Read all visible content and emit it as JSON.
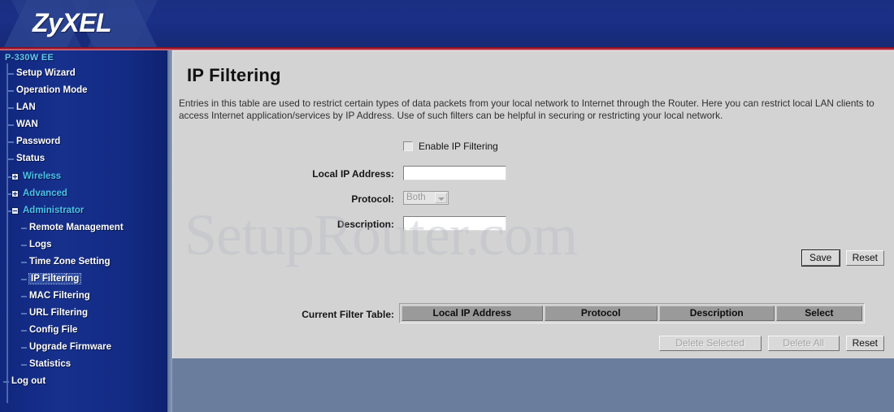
{
  "header": {
    "logo": "ZyXEL"
  },
  "sidebar": {
    "model": "P-330W EE",
    "items": [
      {
        "label": "Setup Wizard",
        "level": 1,
        "style": "white",
        "icon": "none"
      },
      {
        "label": "Operation Mode",
        "level": 1,
        "style": "white",
        "icon": "none"
      },
      {
        "label": "LAN",
        "level": 1,
        "style": "white",
        "icon": "none"
      },
      {
        "label": "WAN",
        "level": 1,
        "style": "white",
        "icon": "none"
      },
      {
        "label": "Password",
        "level": 1,
        "style": "white",
        "icon": "none"
      },
      {
        "label": "Status",
        "level": 1,
        "style": "white",
        "icon": "none"
      },
      {
        "label": "Wireless",
        "level": 1,
        "style": "cyan",
        "icon": "plus-box"
      },
      {
        "label": "Advanced",
        "level": 1,
        "style": "cyan",
        "icon": "plus-box"
      },
      {
        "label": "Administrator",
        "level": 1,
        "style": "cyan",
        "icon": "minus-box"
      },
      {
        "label": "Remote Management",
        "level": 2,
        "style": "white",
        "icon": "none"
      },
      {
        "label": "Logs",
        "level": 2,
        "style": "white",
        "icon": "none"
      },
      {
        "label": "Time Zone Setting",
        "level": 2,
        "style": "white",
        "icon": "none"
      },
      {
        "label": "IP Filtering",
        "level": 2,
        "style": "white",
        "icon": "none",
        "selected": true
      },
      {
        "label": "MAC Filtering",
        "level": 2,
        "style": "white",
        "icon": "none"
      },
      {
        "label": "URL Filtering",
        "level": 2,
        "style": "white",
        "icon": "none"
      },
      {
        "label": "Config File",
        "level": 2,
        "style": "white",
        "icon": "none"
      },
      {
        "label": "Upgrade Firmware",
        "level": 2,
        "style": "white",
        "icon": "none"
      },
      {
        "label": "Statistics",
        "level": 2,
        "style": "white",
        "icon": "none"
      },
      {
        "label": "Log out",
        "level": 0,
        "style": "white",
        "icon": "none"
      }
    ]
  },
  "main": {
    "title": "IP Filtering",
    "intro": "Entries in this table are used to restrict certain types of data packets from your local network to Internet through the Router. Here you can restrict local LAN clients to access Internet application/services by IP Address. Use of such filters can be helpful in securing or restricting your local network.",
    "watermark": "SetupRouter.com",
    "enable_checkbox": {
      "label": "Enable IP Filtering",
      "checked": false
    },
    "fields": {
      "local_ip": {
        "label": "Local IP Address:",
        "value": "",
        "placeholder": ""
      },
      "protocol": {
        "label": "Protocol:",
        "value": "Both",
        "options": [
          "Both"
        ],
        "disabled": true
      },
      "description": {
        "label": "Description:",
        "value": "",
        "placeholder": ""
      }
    },
    "form_buttons": {
      "save": "Save",
      "reset": "Reset"
    },
    "table": {
      "label": "Current Filter Table:",
      "columns": [
        "Local IP Address",
        "Protocol",
        "Description",
        "Select"
      ],
      "rows": []
    },
    "table_buttons": {
      "delete_selected": "Delete Selected",
      "delete_all": "Delete All",
      "reset": "Reset"
    }
  },
  "colors": {
    "header_blue": "#1b2f82",
    "header_red_line": "#a3142a",
    "sidebar_blue": "#16308d",
    "sidebar_cyan": "#4cc3ee",
    "panel_gray": "#d3d3d3",
    "table_header_gray": "#9a9a9a",
    "page_bottom": "#6b7d9c"
  }
}
